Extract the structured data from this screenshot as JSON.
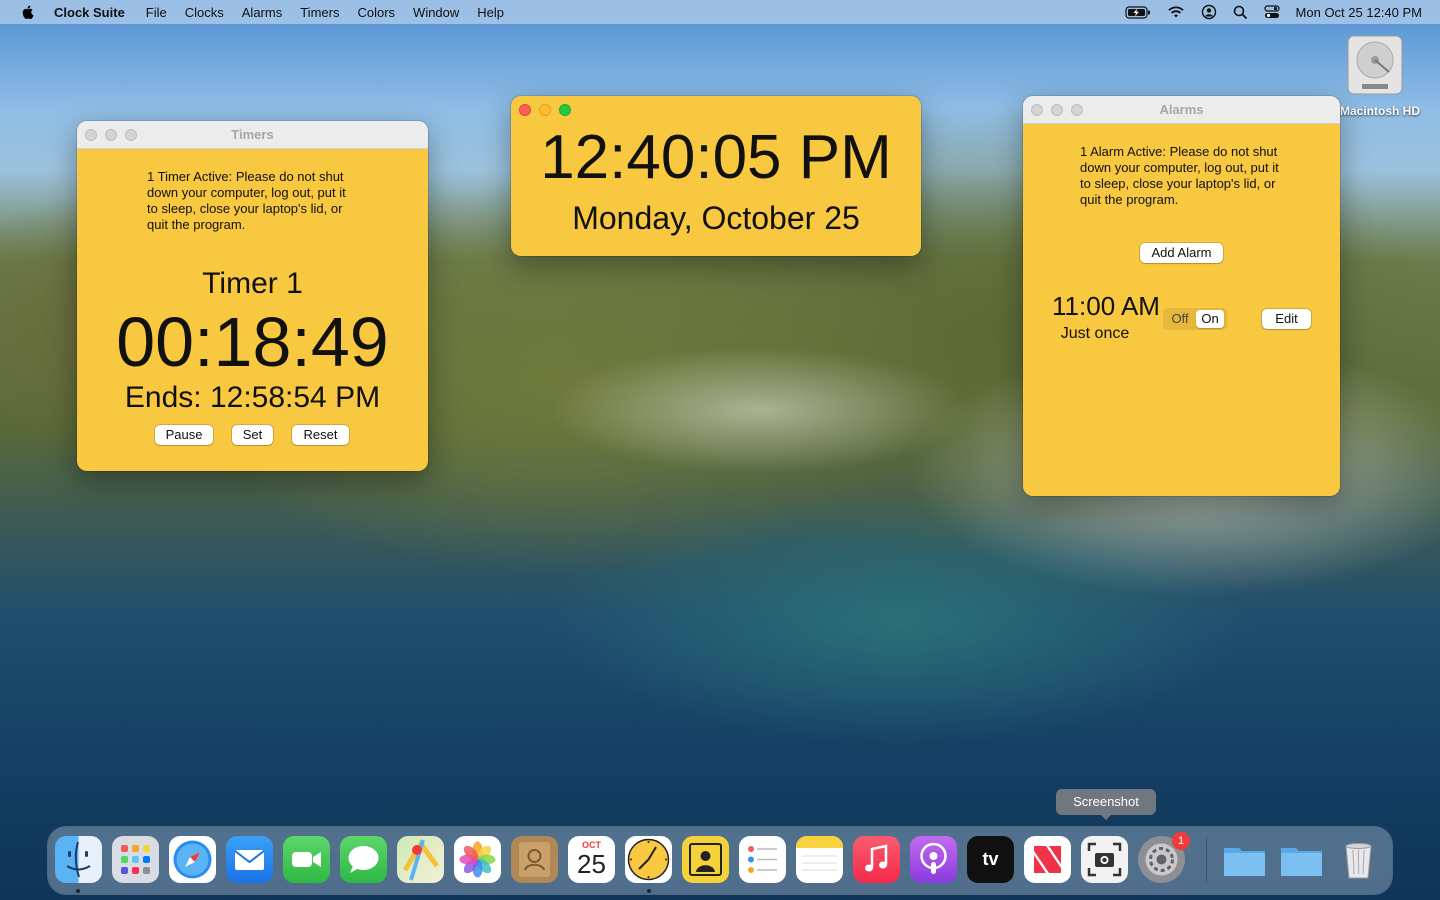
{
  "menubar": {
    "app_name": "Clock Suite",
    "items": [
      "File",
      "Clocks",
      "Alarms",
      "Timers",
      "Colors",
      "Window",
      "Help"
    ],
    "clock": "Mon Oct 25  12:40 PM",
    "status_icons": [
      "battery-icon",
      "wifi-icon",
      "user-icon",
      "search-icon",
      "control-center-icon"
    ]
  },
  "desktop": {
    "disk_label": "Macintosh HD"
  },
  "timers_window": {
    "title": "Timers",
    "notice": "1 Timer Active: Please do not shut down your computer, log out, put it to sleep, close your laptop's lid, or quit the program.",
    "timer_name": "Timer 1",
    "remaining": "00:18:49",
    "ends": "Ends: 12:58:54 PM",
    "buttons": {
      "pause": "Pause",
      "set": "Set",
      "reset": "Reset"
    }
  },
  "clock_window": {
    "time": "12:40:05 PM",
    "date": "Monday, October 25"
  },
  "alarms_window": {
    "title": "Alarms",
    "notice": "1 Alarm Active: Please do not shut down your computer, log out, put it to sleep, close your laptop's lid, or quit the program.",
    "add_button": "Add Alarm",
    "alarm": {
      "time": "11:00 AM",
      "repeat": "Just once",
      "toggle_off": "Off",
      "toggle_on": "On",
      "selected": "On",
      "edit": "Edit"
    }
  },
  "dock": {
    "tooltip": "Screenshot",
    "calendar": {
      "month": "OCT",
      "day": "25"
    },
    "apple_tv_label": "tv",
    "settings_badge": "1",
    "apps": [
      "Finder",
      "Launchpad",
      "Safari",
      "Mail",
      "FaceTime",
      "Messages",
      "Maps",
      "Photos",
      "Contacts",
      "Calendar",
      "Clock Suite",
      "Photo Booth",
      "Reminders",
      "Notes",
      "Music",
      "Podcasts",
      "TV",
      "News",
      "Screenshot",
      "System Preferences",
      "Folder",
      "Folder",
      "Trash"
    ]
  },
  "colors": {
    "window_bg": "#f8c840",
    "accent_close": "#fe5f57",
    "accent_min": "#febc2e",
    "accent_max": "#28c840"
  }
}
